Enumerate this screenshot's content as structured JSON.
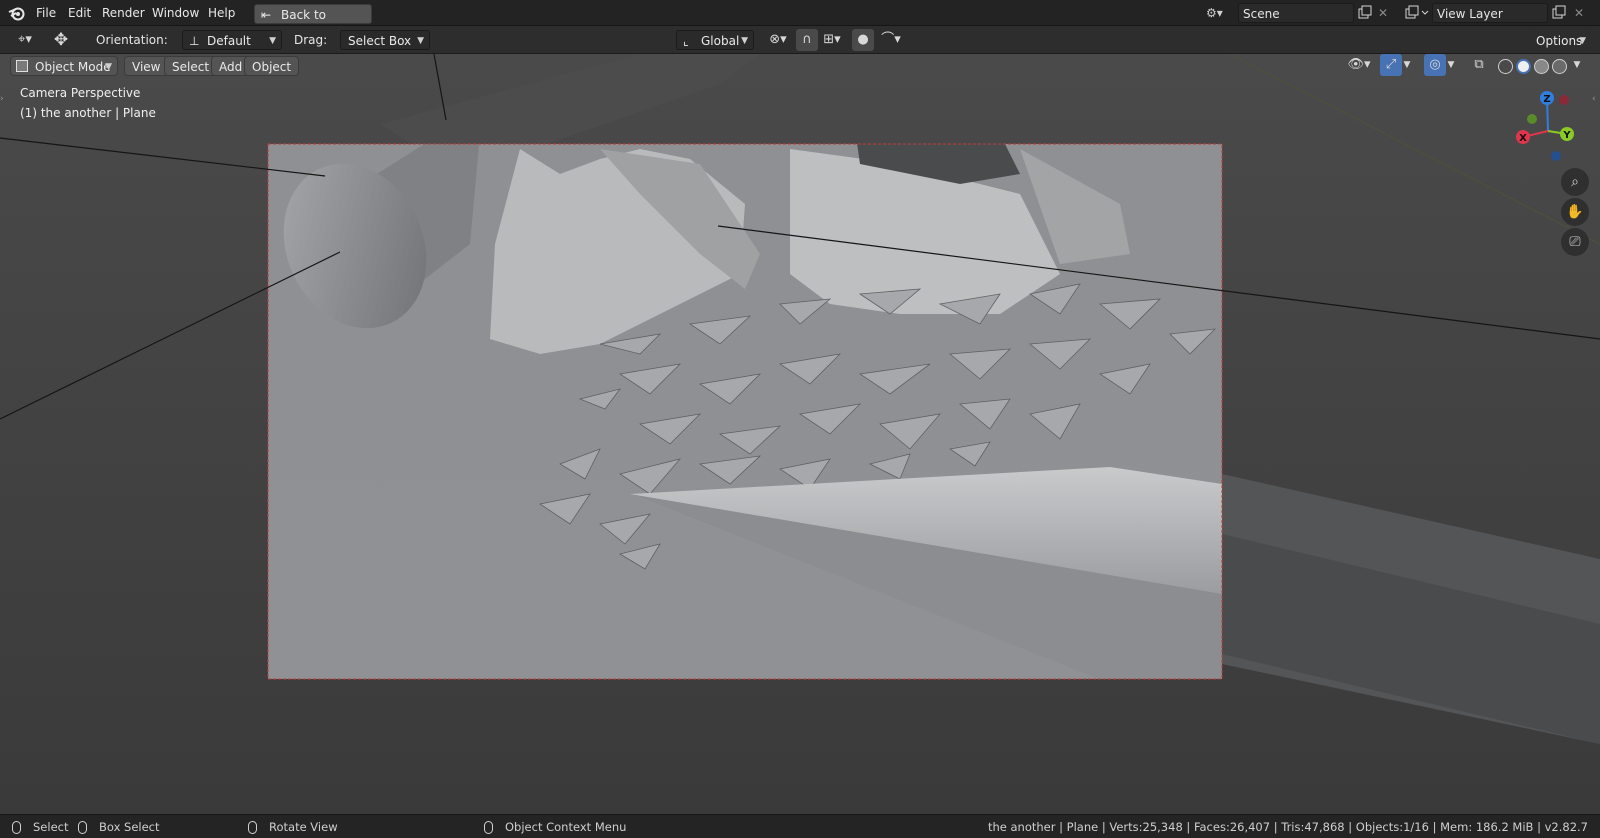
{
  "app": {
    "name": "Blender"
  },
  "topbar": {
    "menus": [
      "File",
      "Edit",
      "Render",
      "Window",
      "Help"
    ],
    "back_button": "Back to Previous",
    "scene_name": "Scene",
    "view_layer_name": "View Layer"
  },
  "toolbar": {
    "orientation_label": "Orientation:",
    "orientation_value": "Default",
    "drag_label": "Drag:",
    "drag_value": "Select Box",
    "transform_orientation": "Global",
    "options_label": "Options"
  },
  "viewport_header": {
    "mode": "Object Mode",
    "menus": [
      "View",
      "Select",
      "Add",
      "Object"
    ]
  },
  "overlay": {
    "view_name": "Camera Perspective",
    "object_info": "(1) the another | Plane"
  },
  "gizmo": {
    "axes": [
      {
        "label": "Z",
        "color": "#2f7ee0"
      },
      {
        "label": "Y",
        "color": "#8bc926"
      },
      {
        "label": "X",
        "color": "#e0364d"
      }
    ]
  },
  "statusbar": {
    "hints": [
      {
        "icon": "mouse-left-icon",
        "label": "Select"
      },
      {
        "icon": "mouse-left-drag-icon",
        "label": "Box Select"
      },
      {
        "icon": "mouse-middle-icon",
        "label": "Rotate View"
      },
      {
        "icon": "mouse-right-icon",
        "label": "Object Context Menu"
      }
    ],
    "stats": "the another | Plane | Verts:25,348 | Faces:26,407 | Tris:47,868 | Objects:1/16 | Mem: 186.2 MiB | v2.82.7"
  },
  "colors": {
    "camera_frame_border": "#c23a3a",
    "camera_region": "#8e9093",
    "topbar_bg": "#232323",
    "header_bg": "#2d2d2d"
  }
}
